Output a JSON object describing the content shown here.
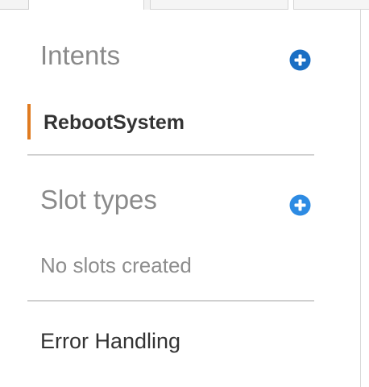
{
  "sidebar": {
    "intents": {
      "title": "Intents",
      "add_icon": "plus-circle-icon",
      "add_color": "#1a6fc4",
      "items": [
        {
          "label": "RebootSystem",
          "selected": true,
          "accent": "#e07b20"
        }
      ]
    },
    "slot_types": {
      "title": "Slot types",
      "add_icon": "plus-circle-icon",
      "add_color": "#2d8be3",
      "empty_text": "No slots created"
    },
    "error_handling": {
      "label": "Error Handling"
    }
  }
}
